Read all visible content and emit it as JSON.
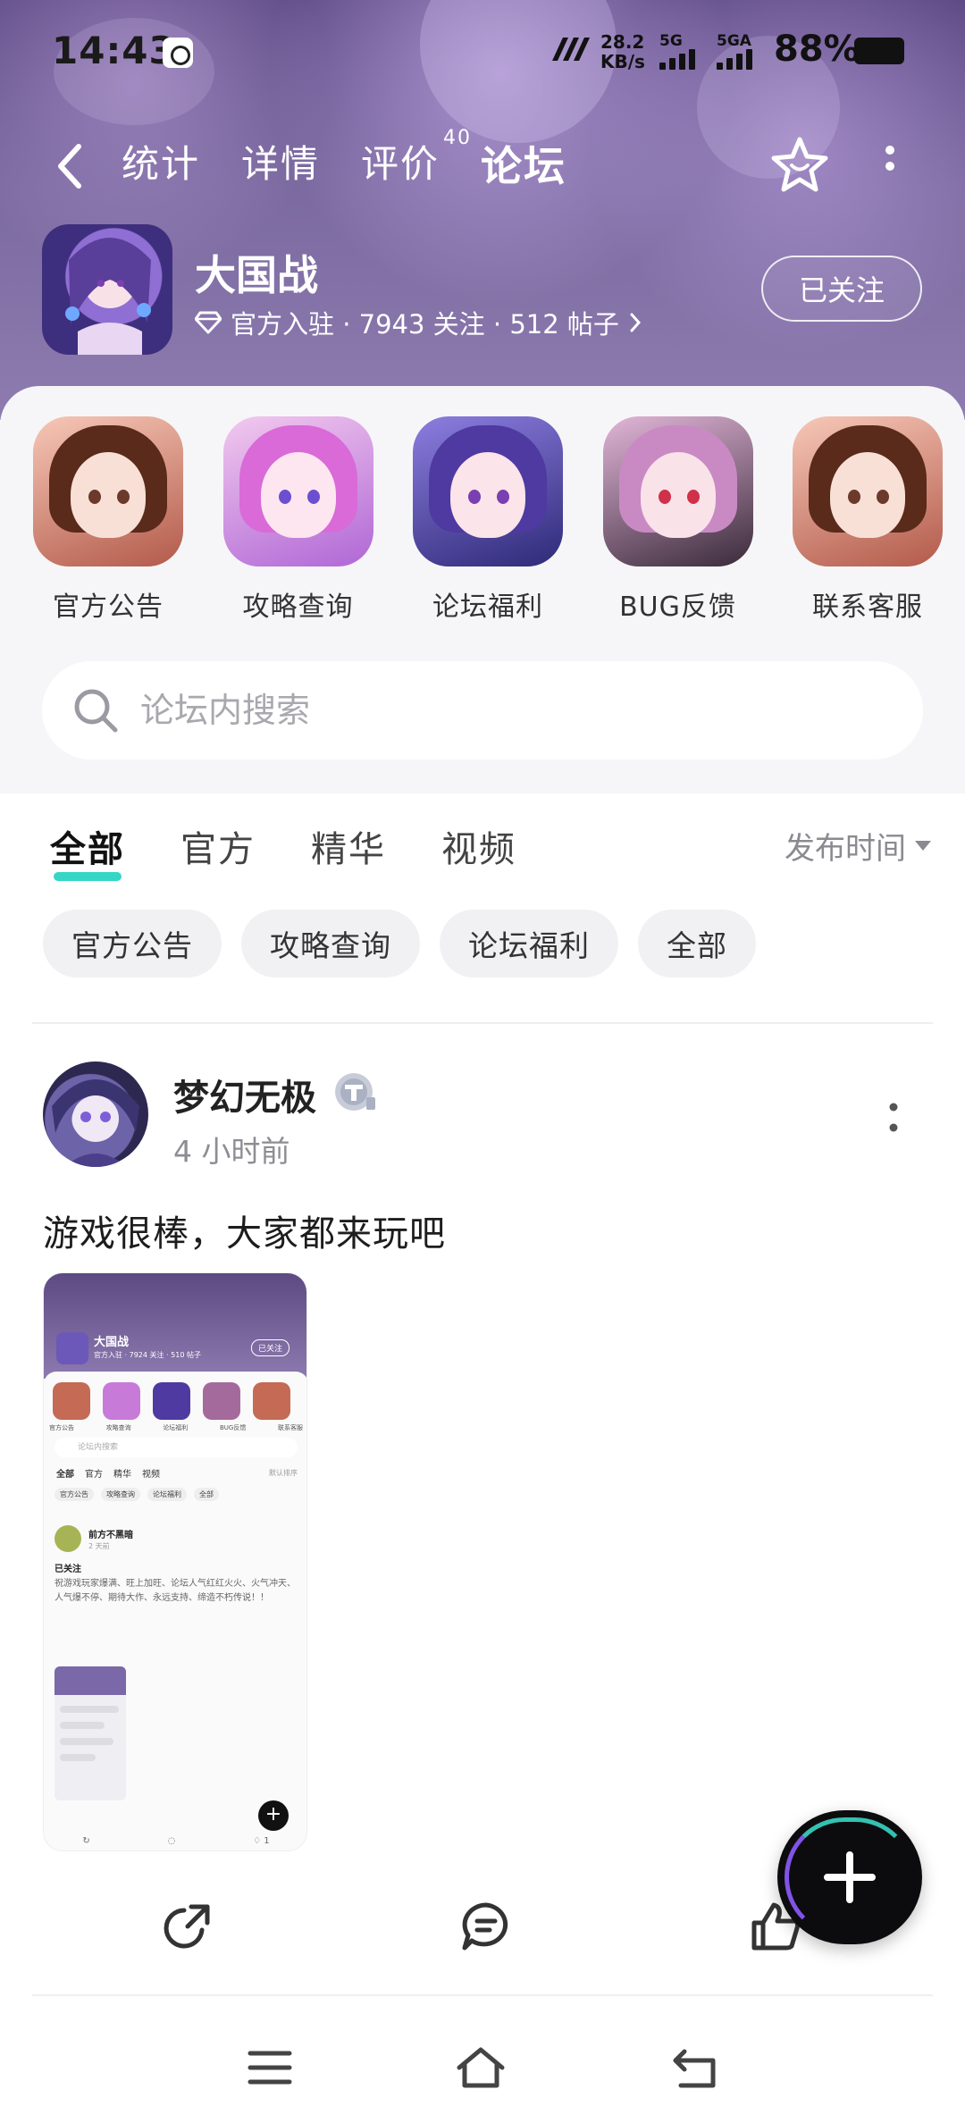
{
  "status_bar": {
    "time": "14:43",
    "net_speed_value": "28.2",
    "net_speed_unit": "KB/s",
    "sim1_label": "5G",
    "sim2_label": "5GA",
    "battery_percent": "88%"
  },
  "nav": {
    "tabs": [
      {
        "label": "统计"
      },
      {
        "label": "详情"
      },
      {
        "label": "评价",
        "badge": "40"
      },
      {
        "label": "论坛"
      }
    ],
    "active_tab_index": 3,
    "accent_color": "#35d6c6"
  },
  "game": {
    "title": "大国战",
    "meta": "官方入驻 · 7943 关注 · 512 帖子",
    "meta_icon": "diamond-icon",
    "follow_label": "已关注"
  },
  "quick_links": [
    {
      "label": "官方公告"
    },
    {
      "label": "攻略查询"
    },
    {
      "label": "论坛福利"
    },
    {
      "label": "BUG反馈"
    },
    {
      "label": "联系客服"
    }
  ],
  "search": {
    "placeholder": "论坛内搜索",
    "value": ""
  },
  "filters": {
    "tabs": [
      {
        "label": "全部"
      },
      {
        "label": "官方"
      },
      {
        "label": "精华"
      },
      {
        "label": "视频"
      }
    ],
    "active_index": 0,
    "sort_label": "发布时间",
    "chips": [
      {
        "label": "官方公告"
      },
      {
        "label": "攻略查询"
      },
      {
        "label": "论坛福利"
      },
      {
        "label": "全部"
      }
    ]
  },
  "post": {
    "author": "梦幻无极",
    "time": "4 小时前",
    "text": "游戏很棒，大家都来玩吧",
    "thumbnail": {
      "title": "大国战",
      "meta": "官方入驻 · 7924 关注 · 510 帖子",
      "follow": "已关注",
      "icons": [
        "官方公告",
        "攻略查询",
        "论坛福利",
        "BUG反馈",
        "联系客服"
      ],
      "search": "论坛内搜索",
      "tabs": [
        "全部",
        "官方",
        "精华",
        "视频"
      ],
      "sort": "默认排序",
      "chips": [
        "官方公告",
        "攻略查询",
        "论坛福利",
        "全部"
      ],
      "author": "前方不黑暗",
      "time": "2 天前",
      "heading": "已关注",
      "body": "祝游戏玩家爆满、旺上加旺、论坛人气红红火火、火气冲天、人气爆不停、期待大作、永远支持、缔造不朽传说！！",
      "like_count": "1"
    }
  },
  "actions": {
    "share": "share-icon",
    "comment": "comment-icon",
    "like": "thumb-up-icon",
    "fab": "plus-icon"
  },
  "system_nav": {
    "menu": "menu-icon",
    "home": "home-icon",
    "back": "back-icon"
  }
}
